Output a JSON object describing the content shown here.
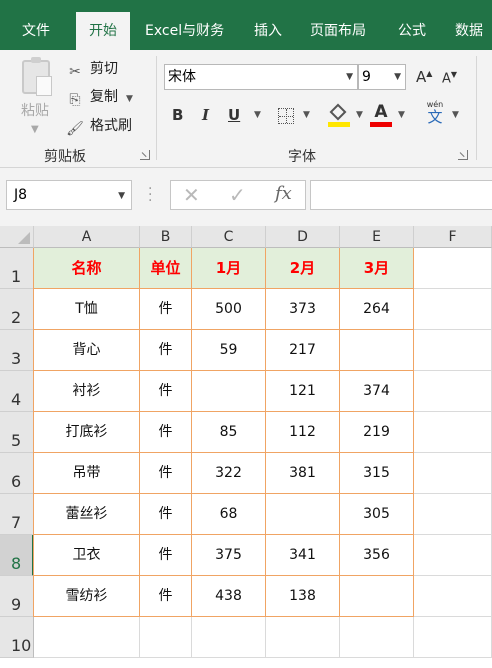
{
  "ribbon": {
    "tabs": [
      "文件",
      "开始",
      "Excel与财务",
      "插入",
      "页面布局",
      "公式",
      "数据"
    ],
    "active_tab": "开始",
    "clipboard": {
      "paste": "粘贴",
      "cut": "剪切",
      "copy": "复制",
      "format_painter": "格式刷",
      "group_label": "剪贴板"
    },
    "font": {
      "name": "宋体",
      "size": "9",
      "bold": "B",
      "italic": "I",
      "underline": "U",
      "grow": "A",
      "shrink": "A",
      "font_color_letter": "A",
      "phonetic_top": "wén",
      "phonetic_char": "文",
      "group_label": "字体",
      "fill_color": "#ffe600",
      "font_color": "#ee0000"
    },
    "accent_color": "#217346"
  },
  "formula_bar": {
    "name_box": "J8",
    "cancel_glyph": "✕",
    "enter_glyph": "✓",
    "fx": "fx",
    "content": ""
  },
  "sheet": {
    "columns": [
      "A",
      "B",
      "C",
      "D",
      "E",
      "F"
    ],
    "rows": [
      "1",
      "2",
      "3",
      "4",
      "5",
      "6",
      "7",
      "8",
      "9",
      "10"
    ],
    "active_row": "8",
    "header_row": [
      "名称",
      "单位",
      "1月",
      "2月",
      "3月"
    ],
    "data": [
      [
        "T恤",
        "件",
        "500",
        "373",
        "264"
      ],
      [
        "背心",
        "件",
        "59",
        "217",
        ""
      ],
      [
        "衬衫",
        "件",
        "",
        "121",
        "374"
      ],
      [
        "打底衫",
        "件",
        "85",
        "112",
        "219"
      ],
      [
        "吊带",
        "件",
        "322",
        "381",
        "315"
      ],
      [
        "蕾丝衫",
        "件",
        "68",
        "",
        "305"
      ],
      [
        "卫衣",
        "件",
        "375",
        "341",
        "356"
      ],
      [
        "雪纺衫",
        "件",
        "438",
        "138",
        ""
      ]
    ],
    "header_fill": "#e2efda",
    "header_text_color": "#ff0000",
    "table_border_color": "#f0a464"
  }
}
